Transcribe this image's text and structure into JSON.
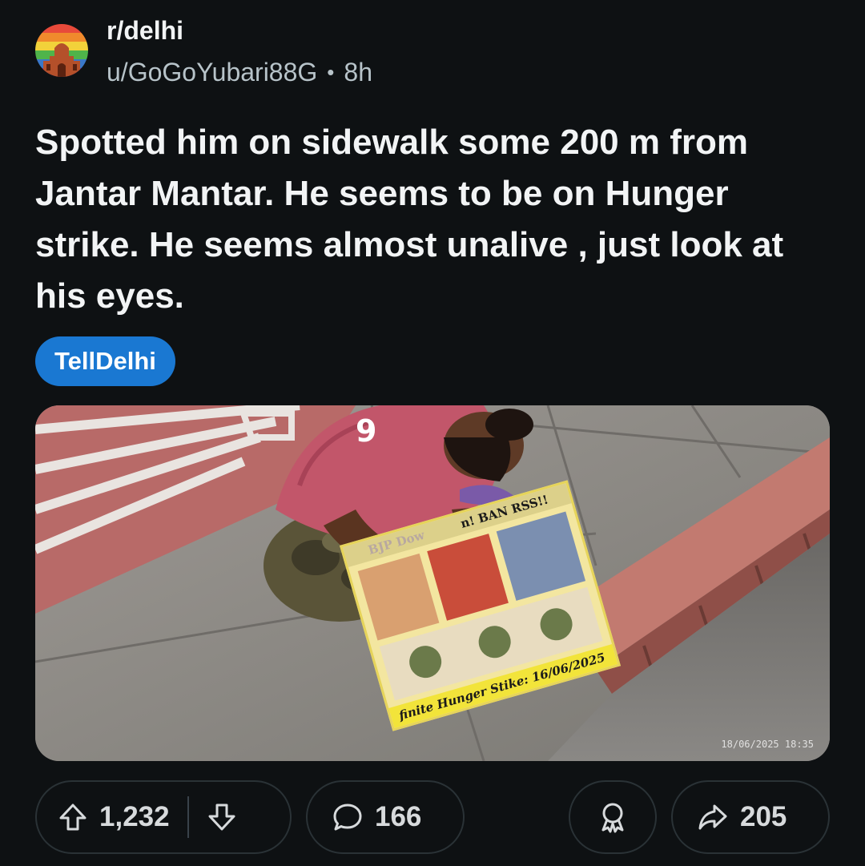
{
  "post": {
    "subreddit": "r/delhi",
    "author": "u/GoGoYubari88G",
    "separator": "•",
    "time": "8h",
    "title": "Spotted him on sidewalk some 200 m from Jantar Mantar. He seems to be on Hunger strike. He seems almost unalive , just look at his eyes.",
    "flair": "TellDelhi"
  },
  "image": {
    "shirt_number": "9",
    "sign_headline_left": "BJP Dow",
    "sign_headline_right": "n! BAN RSS!!",
    "sign_footer": "finite Hunger Stike: 16/06/2025",
    "timestamp": "18/06/2025 18:35"
  },
  "actions": {
    "upvotes": "1,232",
    "comments": "166",
    "shares": "205"
  },
  "colors": {
    "background": "#0e1113",
    "flair": "#1a78d2",
    "pill_border": "#2a3236"
  }
}
